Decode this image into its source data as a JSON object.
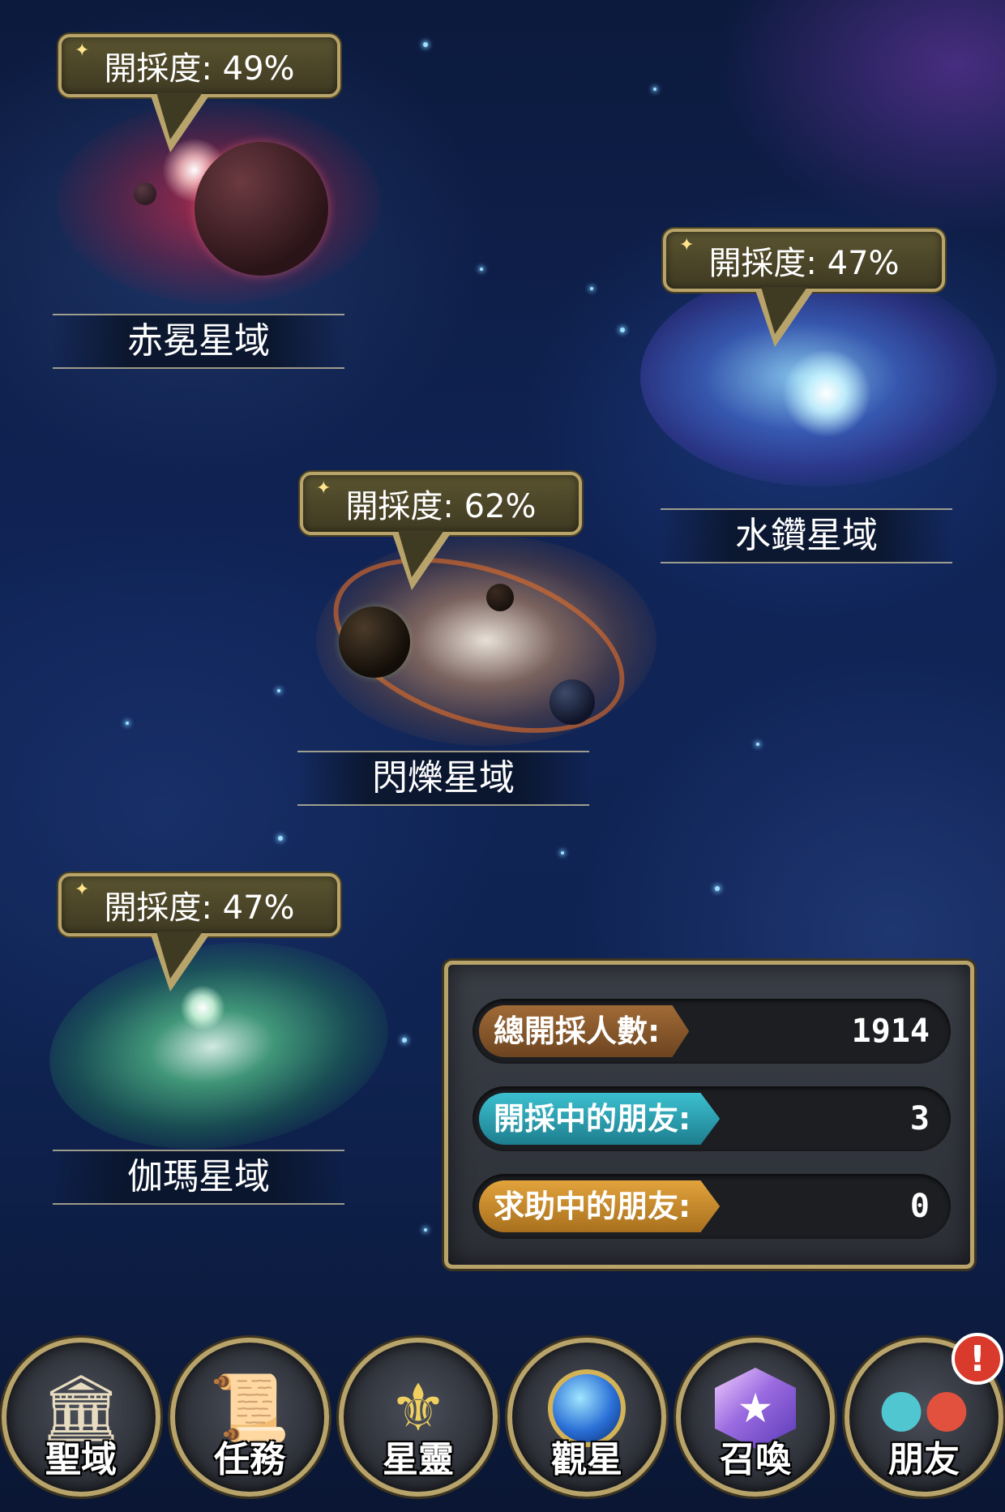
{
  "progress_label": "開採度:",
  "regions": [
    {
      "name": "赤冕星域",
      "progress": "49%"
    },
    {
      "name": "水鑽星域",
      "progress": "47%"
    },
    {
      "name": "閃爍星域",
      "progress": "62%"
    },
    {
      "name": "伽瑪星域",
      "progress": "47%"
    }
  ],
  "stats": {
    "total_label": "總開採人數:",
    "total_value": "1914",
    "friends_mining_label": "開採中的朋友:",
    "friends_mining_value": "3",
    "friends_help_label": "求助中的朋友:",
    "friends_help_value": "0",
    "colors": {
      "total_tag": "#8a5a2b",
      "friends_mining_tag": "#2a9fb0",
      "friends_help_tag": "#c88a2a"
    }
  },
  "nav": [
    {
      "label": "聖域",
      "icon": "temple-icon"
    },
    {
      "label": "任務",
      "icon": "scroll-icon"
    },
    {
      "label": "星靈",
      "icon": "helmet-icon"
    },
    {
      "label": "觀星",
      "icon": "orb-icon"
    },
    {
      "label": "召喚",
      "icon": "crystal-icon"
    },
    {
      "label": "朋友",
      "icon": "friends-icon",
      "alert": "!"
    }
  ]
}
